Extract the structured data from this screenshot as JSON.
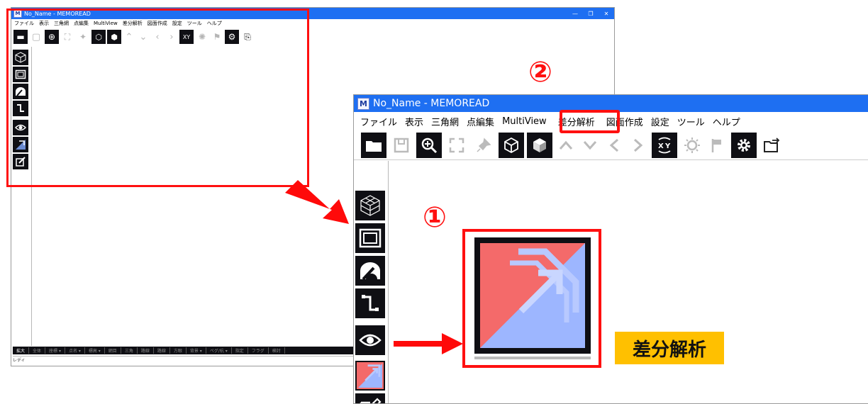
{
  "small_window": {
    "app_title": "No_Name - MEMOREAD",
    "logo_letter": "M",
    "menu": [
      "ファイル",
      "表示",
      "三角網",
      "点編集",
      "MultiView",
      "差分解析",
      "図面作成",
      "設定",
      "ツール",
      "ヘルプ"
    ],
    "status_items": [
      "拡大",
      "全体",
      "座標 ▾",
      "点名 ▾",
      "標高 ▾",
      "網目",
      "三角",
      "路線",
      "路線",
      "方眼",
      "背景 ▾",
      "ペグ/杭 ▾",
      "指定",
      "フラグ",
      "検討"
    ],
    "status_text": "レディ"
  },
  "large_window": {
    "app_title": "No_Name - MEMOREAD",
    "logo_letter": "M",
    "menu": [
      "ファイル",
      "表示",
      "三角網",
      "点編集",
      "MultiView",
      "差分解析",
      "図面作成",
      "設定",
      "ツール",
      "ヘルプ"
    ]
  },
  "annotations": {
    "marker_1": "①",
    "marker_2": "②",
    "feature_label": "差分解析",
    "accent_color": "#ff1010",
    "label_bg": "#ffc000",
    "highlight_icon_bg": "#f46a6a"
  }
}
